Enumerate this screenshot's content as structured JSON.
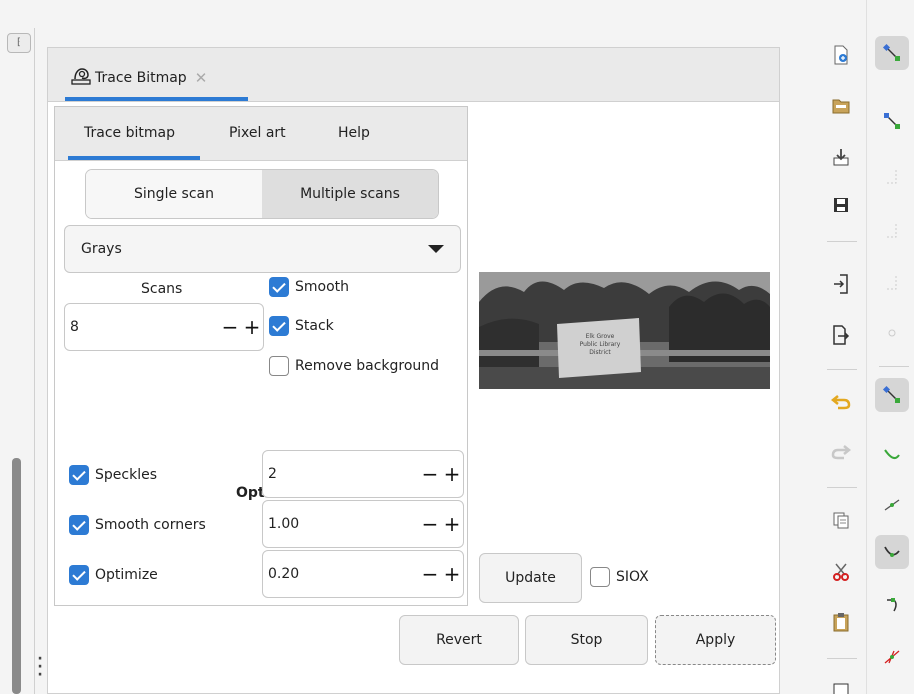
{
  "dialog": {
    "tab_title": "Trace Bitmap",
    "tab_close_icon": "close-icon"
  },
  "subtabs": [
    "Trace bitmap",
    "Pixel art",
    "Help"
  ],
  "scan_mode": {
    "single": "Single scan",
    "multiple": "Multiple scans",
    "selected": "Multiple scans"
  },
  "mode_dropdown": {
    "value": "Grays"
  },
  "scans": {
    "label": "Scans",
    "value": "8"
  },
  "checks": {
    "smooth": {
      "label": "Smooth",
      "checked": true
    },
    "stack": {
      "label": "Stack",
      "checked": true
    },
    "remove_background": {
      "label": "Remove background",
      "checked": false
    }
  },
  "options": {
    "title": "Options",
    "speckles": {
      "label": "Speckles",
      "checked": true,
      "value": "2"
    },
    "smooth_corners": {
      "label": "Smooth corners",
      "checked": true,
      "value": "1.00"
    },
    "optimize": {
      "label": "Optimize",
      "checked": true,
      "value": "0.20"
    }
  },
  "preview": {
    "sign_lines": [
      "Elk Grove",
      "Public Library",
      "District"
    ]
  },
  "update_button": "Update",
  "siox": {
    "label": "SIOX",
    "checked": false
  },
  "actions": {
    "revert": "Revert",
    "stop": "Stop",
    "apply": "Apply"
  },
  "spin": {
    "minus": "−",
    "plus": "+"
  },
  "mini_tab_glyph": "⁅",
  "colors": {
    "accent": "#2d7bd4",
    "selected_bg": "#d6d6d6"
  },
  "toolbar_right_icons": [
    "new-document-icon",
    "open-folder-icon",
    "import-icon",
    "save-icon",
    "import-into-icon",
    "export-icon",
    "undo-icon",
    "redo-icon",
    "copy-icon",
    "cut-icon",
    "paste-icon",
    "duplicate-icon"
  ],
  "snap_icons": [
    "snap-nodes-icon",
    "snap-node-alt-icon",
    "snap-guide-icon",
    "snap-guide-alt-icon",
    "snap-corner-icon",
    "snap-midpoint-icon",
    "snap-bezier-icon",
    "snap-smooth-icon",
    "snap-line-icon",
    "snap-curve-icon",
    "snap-path-icon",
    "snap-intersection-icon"
  ]
}
